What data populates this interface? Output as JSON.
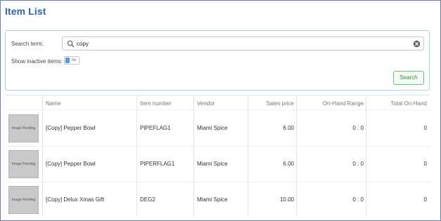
{
  "page": {
    "title": "Item List"
  },
  "search": {
    "term_label": "Search term:",
    "term_value": "copy",
    "inactive_label": "Show inactive items:",
    "inactive_toggle": "No",
    "button_label": "Search"
  },
  "table": {
    "headers": {
      "name": "Name",
      "item_number": "Item number",
      "vendor": "Vendor",
      "sales_price": "Sales price",
      "on_hand_range": "On-Hand Range",
      "total_on_hand": "Total On-Hand"
    },
    "rows": [
      {
        "image": "Image Pending",
        "name": "[Copy] Pepper Bowl",
        "item_number": "PIPEFLAG1",
        "vendor": "Miami Spice",
        "sales_price": "6.00",
        "on_hand_range": "0 : 0",
        "total_on_hand": "0"
      },
      {
        "image": "Image Pending",
        "name": "[Copy] Pepper Bowl",
        "item_number": "PIPERFLAG1",
        "vendor": "Miami Spice",
        "sales_price": "6.00",
        "on_hand_range": "0 : 0",
        "total_on_hand": "0"
      },
      {
        "image": "Image Pending",
        "name": "[Copy] Delux Xmas Gift",
        "item_number": "DEG2",
        "vendor": "Miami Spice",
        "sales_price": "10.00",
        "on_hand_range": "0 : 0",
        "total_on_hand": "0"
      }
    ]
  },
  "colors": {
    "title": "#2f63a9",
    "panel_border": "#a9cfe0",
    "search_button": "#3a8a3a",
    "toggle_knob": "#5b9bd5"
  }
}
